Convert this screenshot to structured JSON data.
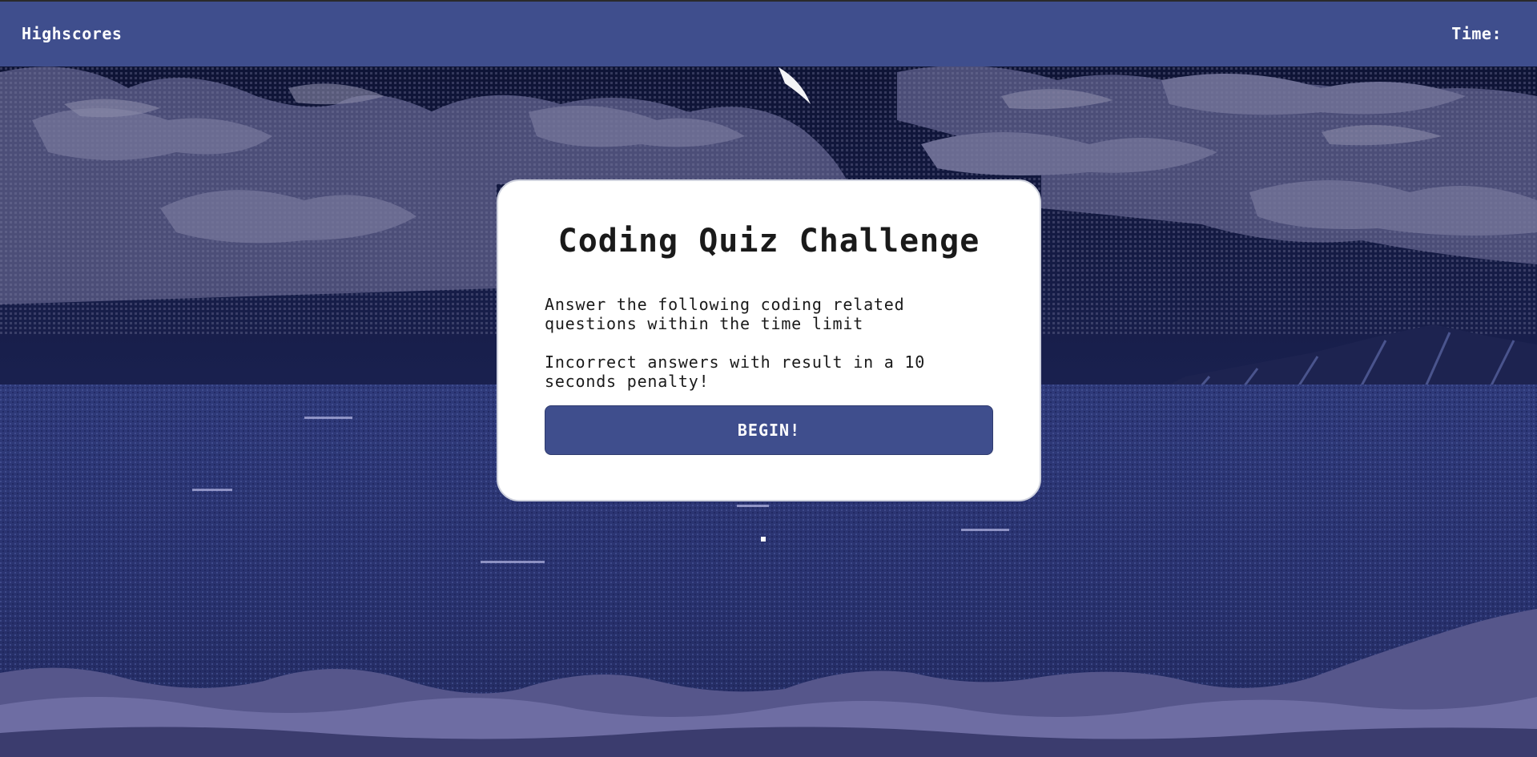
{
  "nav": {
    "highscores_label": "Highscores",
    "time_label": "Time:",
    "time_value": ""
  },
  "quiz": {
    "title": "Coding Quiz Challenge",
    "intro": "Answer the following coding related questions within the time limit",
    "penalty": "Incorrect answers with result in a 10 seconds penalty!",
    "begin_label": "BEGIN!"
  },
  "colors": {
    "header_bg": "#3f4e8d",
    "button_bg": "#3f4e8d",
    "card_bg": "#ffffff",
    "sky_dark": "#0d1233",
    "cloud": "#5e5f86",
    "sea": "#303a78"
  }
}
